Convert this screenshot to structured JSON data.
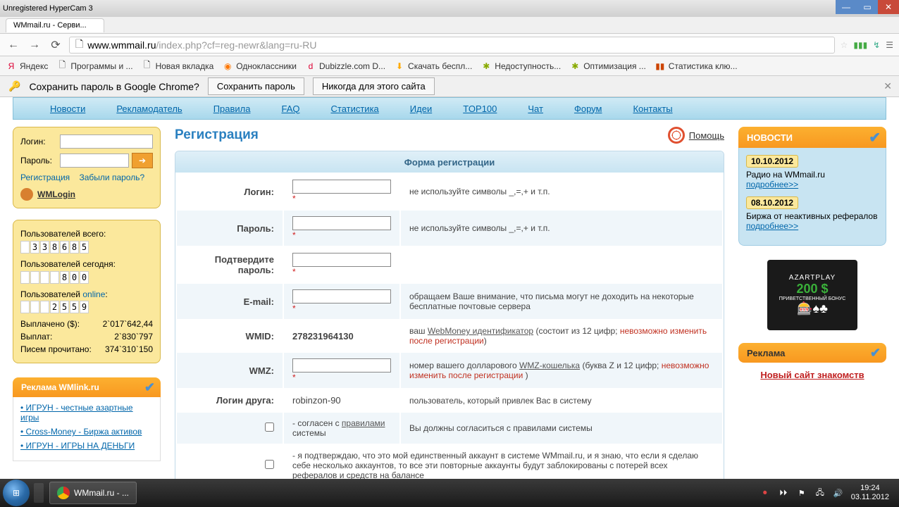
{
  "window": {
    "title": "Unregistered HyperCam 3",
    "tab_title": "WMmail.ru - Серви..."
  },
  "browser": {
    "url_domain": "www.wmmail.ru",
    "url_path": "/index.php?cf=reg-newr&lang=ru-RU",
    "bookmarks": [
      "Яндекс",
      "Программы и ...",
      "Новая вкладка",
      "Одноклассники",
      "Dubizzle.com D...",
      "Скачать беспл...",
      "Недоступность...",
      "Оптимизация ...",
      "Статистика клю..."
    ],
    "save_pw_prompt": "Сохранить пароль в Google Chrome?",
    "save_pw_btn": "Сохранить пароль",
    "never_btn": "Никогда для этого сайта"
  },
  "nav": [
    "Новости",
    "Рекламодатель",
    "Правила",
    "FAQ",
    "Статистика",
    "Идеи",
    "TOP100",
    "Чат",
    "Форум",
    "Контакты"
  ],
  "login": {
    "login_label": "Логин:",
    "password_label": "Пароль:",
    "register": "Регистрация",
    "forgot": "Забыли пароль?",
    "wmlogin": "WMLogin"
  },
  "stats": {
    "total_label": "Пользователей всего:",
    "total_digits": [
      "",
      "3",
      "3",
      "8",
      "6",
      "8",
      "5"
    ],
    "today_label": "Пользователей сегодня:",
    "today_digits": [
      "",
      "",
      "",
      "",
      "8",
      "0",
      "0"
    ],
    "online_label": "Пользователей ",
    "online_link": "online",
    "online_digits": [
      "",
      "",
      "",
      "2",
      "5",
      "5",
      "9"
    ],
    "paid_usd_label": "Выплачено ($):",
    "paid_usd": "2`017`642,44",
    "paid_count_label": "Выплат:",
    "paid_count": "2`830`797",
    "letters_label": "Писем прочитано:",
    "letters": "374`310`150"
  },
  "adbox": {
    "title": "Реклама WMlink.ru",
    "links": [
      "• ИГРУН - честные азартные игры",
      "• Cross-Money - Биржа активов",
      "• ИГРУН - ИГРЫ НА ДЕНЬГИ"
    ]
  },
  "reg": {
    "title": "Регистрация",
    "help": "Помощь",
    "form_title": "Форма регистрации",
    "rows": {
      "login_label": "Логин",
      "login_hint": "не используйте символы _,=,+ и т.п.",
      "pw_label": "Пароль",
      "pw_hint": "не используйте символы _,=,+ и т.п.",
      "pw2_label": "Подтвердите пароль",
      "email_label": "E-mail",
      "email_hint": "обращаем Ваше внимание, что письма могут не доходить на некоторые бесплатные почтовые сервера",
      "wmid_label": "WMID",
      "wmid_value": "278231964130",
      "wmid_hint1": "ваш ",
      "wmid_link": "WebMoney идентификатор",
      "wmid_hint2": " (состоит из 12 цифр; ",
      "wmid_warn": "невозможно изменить после регистрации",
      "wmid_hint3": ")",
      "wmz_label": "WMZ",
      "wmz_hint1": "номер вашего долларового ",
      "wmz_link": "WMZ-кошелька",
      "wmz_hint2": " (буква Z и 12 цифр; ",
      "wmz_warn": "невозможно изменить после регистрации",
      "wmz_hint3": " )",
      "friend_label": "Логин друга",
      "friend_value": "robinzon-90",
      "friend_hint": "пользователь, который привлек Вас в систему",
      "agree1_a": "- согласен с ",
      "agree1_link": "правилами",
      "agree1_b": " системы",
      "agree1_hint": "Вы должны согласиться с правилами системы",
      "agree2": "- я подтверждаю, что это мой единственный аккаунт в системе WMmail.ru, и я знаю, что если я сделаю себе несколько аккаунтов, то все эти повторные аккаунты будут заблокированы с потерей всех рефералов и средств на балансе"
    }
  },
  "right": {
    "news_title": "НОВОСТИ",
    "news": [
      {
        "date": "10.10.2012",
        "text": "Радио на WMmail.ru",
        "more": "подробнее>>"
      },
      {
        "date": "08.10.2012",
        "text": "Биржа от неактивных рефералов",
        "more": "подробнее>>"
      }
    ],
    "banner_logo": "AZARTPLAY",
    "banner_amt": "200 $",
    "banner_txt": "ПРИВЕТСТВЕННЫЙ БОНУС",
    "ad_title": "Реклама",
    "dating": "Новый сайт знакомств"
  },
  "taskbar": {
    "task": "WMmail.ru - ...",
    "time": "19:24",
    "date": "03.11.2012"
  }
}
